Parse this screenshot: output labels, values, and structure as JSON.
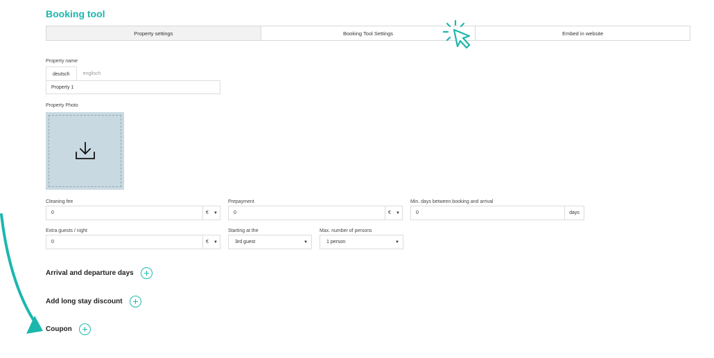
{
  "page": {
    "title": "Booking tool"
  },
  "tabs": [
    {
      "label": "Property settings",
      "active": true
    },
    {
      "label": "Booking Tool Settings",
      "active": false
    },
    {
      "label": "Embed in website",
      "active": false
    }
  ],
  "property": {
    "name_label": "Property name",
    "languages": [
      "deutsch",
      "englisch"
    ],
    "name_value": "Property 1",
    "photo_label": "Property Photo"
  },
  "fees": {
    "cleaning": {
      "label": "Cleaning fee",
      "value": "0",
      "currency": "€"
    },
    "prepayment": {
      "label": "Prepayment",
      "value": "0",
      "currency": "€"
    },
    "min_days": {
      "label": "Min. days between booking and arrival",
      "value": "0",
      "unit": "days"
    },
    "extra_guests": {
      "label": "Extra guests / night",
      "value": "0",
      "currency": "€"
    },
    "starting_at": {
      "label": "Starting at the",
      "value": "3rd guest"
    },
    "max_persons": {
      "label": "Max. number of persons",
      "value": "1 person"
    }
  },
  "sections": {
    "arrival": "Arrival and departure days",
    "long_stay": "Add long stay discount",
    "coupon": "Coupon"
  },
  "colors": {
    "accent": "#1bb7ad"
  },
  "icons": {
    "upload": "download-arrow-icon",
    "cursor": "pointer-cursor-icon",
    "add": "plus-circle-icon"
  }
}
